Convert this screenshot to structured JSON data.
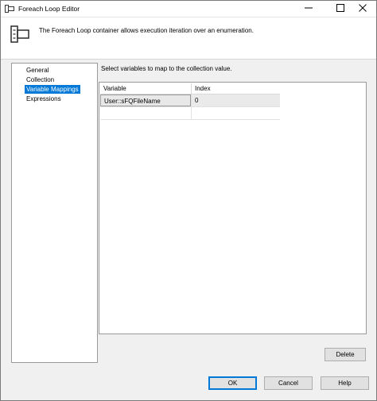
{
  "window": {
    "title": "Foreach Loop Editor"
  },
  "header": {
    "description": "The Foreach Loop container allows execution iteration over an enumeration."
  },
  "nav": {
    "items": [
      {
        "label": "General",
        "selected": false
      },
      {
        "label": "Collection",
        "selected": false
      },
      {
        "label": "Variable Mappings",
        "selected": true
      },
      {
        "label": "Expressions",
        "selected": false
      }
    ]
  },
  "content": {
    "instruction": "Select variables to map to the collection value.",
    "columns": [
      "Variable",
      "Index"
    ],
    "rows": [
      {
        "variable": "User::sFQFileName",
        "index": "0"
      },
      {
        "variable": "",
        "index": ""
      }
    ],
    "delete_label": "Delete"
  },
  "footer": {
    "ok_label": "OK",
    "cancel_label": "Cancel",
    "help_label": "Help"
  },
  "colors": {
    "selection": "#0078d7",
    "window_bg": "#f0f0f0"
  }
}
